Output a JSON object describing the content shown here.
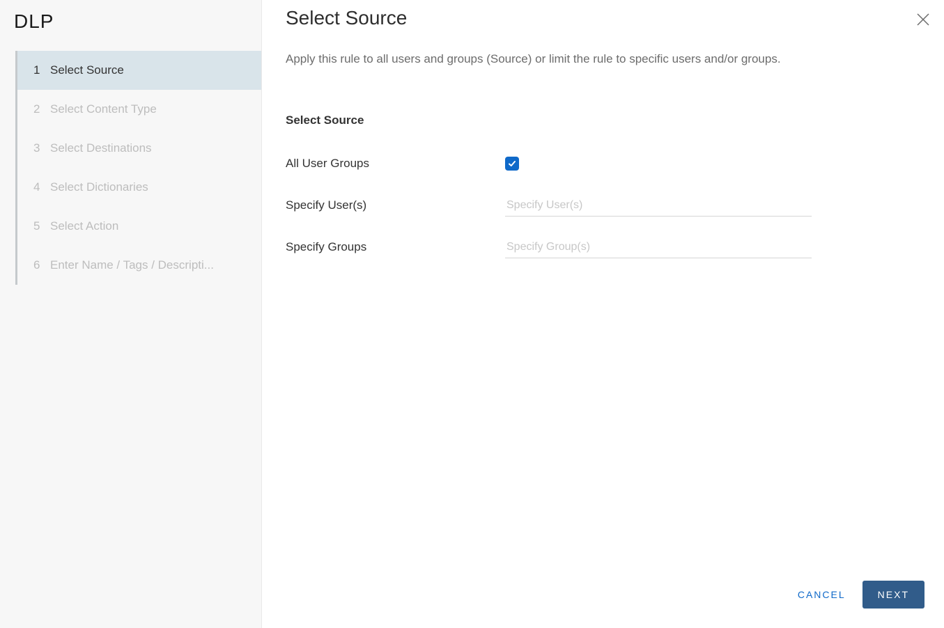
{
  "sidebar": {
    "brand": "DLP",
    "steps": [
      {
        "num": "1",
        "label": "Select Source",
        "active": true
      },
      {
        "num": "2",
        "label": "Select Content Type",
        "active": false
      },
      {
        "num": "3",
        "label": "Select Destinations",
        "active": false
      },
      {
        "num": "4",
        "label": "Select Dictionaries",
        "active": false
      },
      {
        "num": "5",
        "label": "Select Action",
        "active": false
      },
      {
        "num": "6",
        "label": "Enter Name / Tags / Descripti...",
        "active": false
      }
    ]
  },
  "main": {
    "title": "Select Source",
    "description": "Apply this rule to all users and groups (Source) or limit the rule to specific users and/or groups.",
    "section_header": "Select Source",
    "fields": {
      "all_user_groups_label": "All User Groups",
      "all_user_groups_checked": true,
      "specify_users_label": "Specify User(s)",
      "specify_users_placeholder": "Specify User(s)",
      "specify_groups_label": "Specify Groups",
      "specify_groups_placeholder": "Specify Group(s)"
    }
  },
  "footer": {
    "cancel": "CANCEL",
    "next": "NEXT"
  }
}
